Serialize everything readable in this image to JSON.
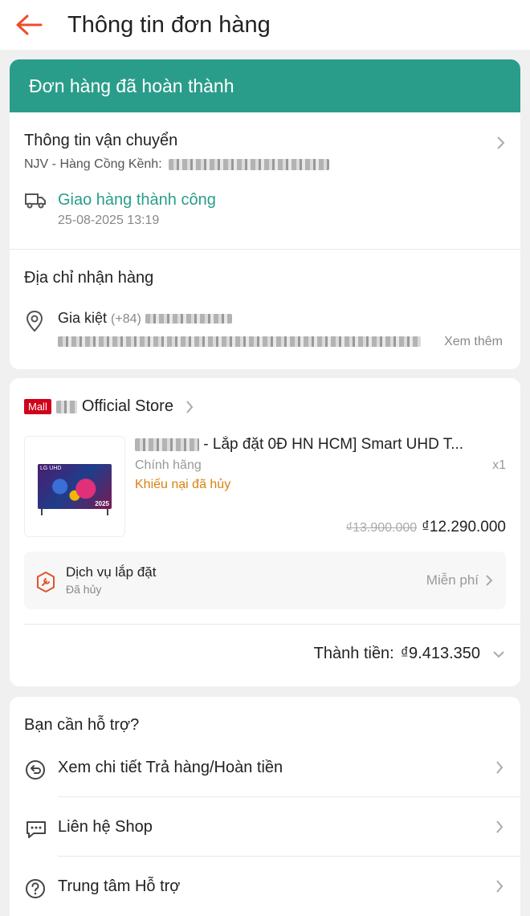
{
  "header": {
    "title": "Thông tin đơn hàng"
  },
  "status": {
    "banner": "Đơn hàng đã hoàn thành"
  },
  "shipping": {
    "title": "Thông tin vận chuyển",
    "carrier": "NJV - Hàng Cồng Kềnh:",
    "status": "Giao hàng thành công",
    "time": "25-08-2025 13:19"
  },
  "address": {
    "title": "Địa chỉ nhận hàng",
    "name": "Gia kiệt",
    "phone_prefix": "(+84)",
    "see_more": "Xem thêm"
  },
  "shop": {
    "badge": "Mall",
    "name": "Official Store"
  },
  "product": {
    "name": "- Lắp đặt 0Đ HN HCM] Smart UHD T...",
    "variant": "Chính hãng",
    "qty": "x1",
    "claim": "Khiếu nại đã hủy",
    "price_old": "₫13.900.000",
    "price_new": "₫12.290.000",
    "img_logo": "LG UHD",
    "img_year": "2025"
  },
  "service": {
    "title": "Dịch vụ lắp đặt",
    "status": "Đã hủy",
    "price": "Miễn phí"
  },
  "total": {
    "label": "Thành tiền:",
    "value": "₫9.413.350"
  },
  "help": {
    "title": "Bạn cần hỗ trợ?",
    "items": [
      {
        "label": "Xem chi tiết Trả hàng/Hoàn tiền",
        "icon": "return-icon"
      },
      {
        "label": "Liên hệ Shop",
        "icon": "chat-icon"
      },
      {
        "label": "Trung tâm Hỗ trợ",
        "icon": "help-icon"
      }
    ]
  },
  "colors": {
    "accent": "#2a9d8a",
    "back_arrow": "#ee4d2d",
    "claim": "#d98211",
    "mall": "#d0011b"
  }
}
